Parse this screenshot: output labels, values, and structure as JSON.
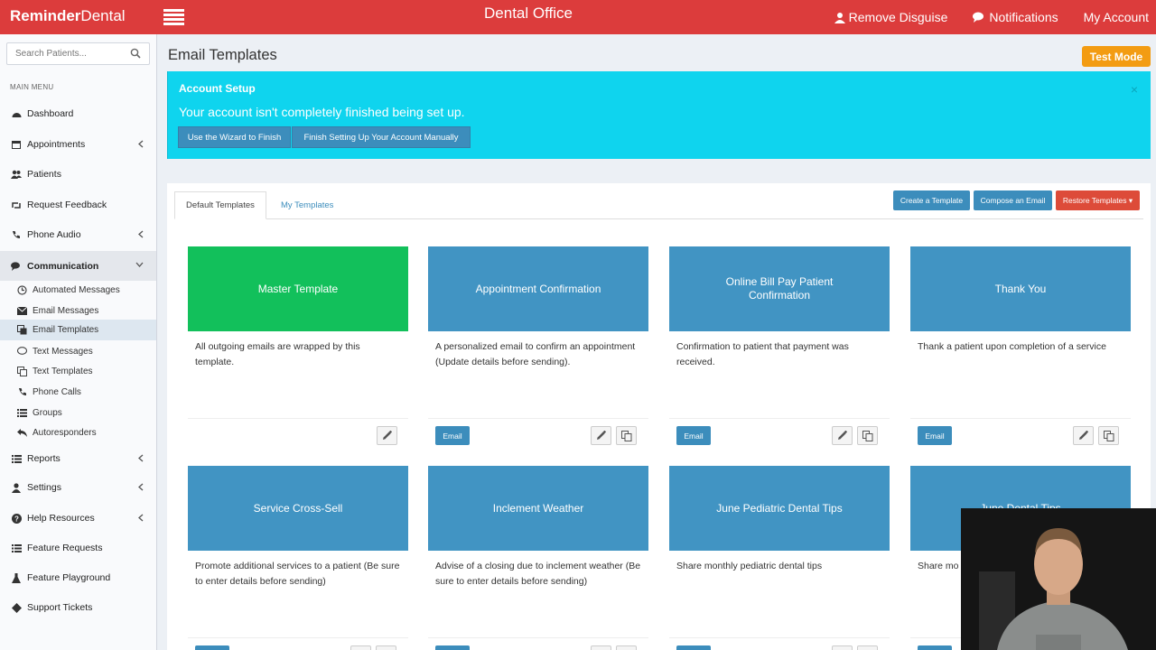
{
  "header": {
    "brand_bold": "Reminder",
    "brand_rest": "Dental",
    "office": "Dental Office",
    "remove_disguise": "Remove Disguise",
    "notifications": "Notifications",
    "my_account": "My Account"
  },
  "sidebar": {
    "search_placeholder": "Search Patients...",
    "menu_header": "MAIN MENU",
    "items": [
      {
        "label": "Dashboard"
      },
      {
        "label": "Appointments"
      },
      {
        "label": "Patients"
      },
      {
        "label": "Request Feedback"
      },
      {
        "label": "Phone Audio"
      },
      {
        "label": "Communication"
      },
      {
        "label": "Reports"
      },
      {
        "label": "Settings"
      },
      {
        "label": "Help Resources"
      },
      {
        "label": "Feature Requests"
      },
      {
        "label": "Feature Playground"
      },
      {
        "label": "Support Tickets"
      }
    ],
    "sub_items": [
      {
        "label": "Automated Messages"
      },
      {
        "label": "Email Messages"
      },
      {
        "label": "Email Templates"
      },
      {
        "label": "Text Messages"
      },
      {
        "label": "Text Templates"
      },
      {
        "label": "Phone Calls"
      },
      {
        "label": "Groups"
      },
      {
        "label": "Autoresponders"
      }
    ]
  },
  "page": {
    "title": "Email Templates",
    "test_mode": "Test Mode"
  },
  "setup": {
    "title": "Account Setup",
    "message": "Your account isn't completely finished being set up.",
    "close": "×",
    "wizard_button": "Use the Wizard to Finish",
    "manual_button": "Finish Setting Up Your Account Manually"
  },
  "tabs": {
    "default": "Default Templates",
    "mine": "My Templates"
  },
  "actions": {
    "create": "Create a Template",
    "compose": "Compose an Email",
    "restore": "Restore Templates ▾"
  },
  "email_label": "Email",
  "templates": [
    {
      "title": "Master Template",
      "desc": "All outgoing emails are wrapped by this template.",
      "color": "#12c05b"
    },
    {
      "title": "Appointment Confirmation",
      "desc": "A personalized email to confirm an appointment (Update details before sending).",
      "color": "#4194c3"
    },
    {
      "title": "Online Bill Pay Patient Confirmation",
      "desc": "Confirmation to patient that payment was received.",
      "color": "#4194c3"
    },
    {
      "title": "Thank You",
      "desc": "Thank a patient upon completion of a service",
      "color": "#4194c3"
    },
    {
      "title": "Service Cross-Sell",
      "desc": "Promote additional services to a patient (Be sure to enter details before sending)",
      "color": "#4194c3"
    },
    {
      "title": "Inclement Weather",
      "desc": "Advise of a closing due to inclement weather (Be sure to enter details before sending)",
      "color": "#4194c3"
    },
    {
      "title": "June Pediatric Dental Tips",
      "desc": "Share monthly pediatric dental tips",
      "color": "#4194c3"
    },
    {
      "title": "June Dental Tips",
      "desc": "Share mo",
      "color": "#4194c3"
    }
  ]
}
